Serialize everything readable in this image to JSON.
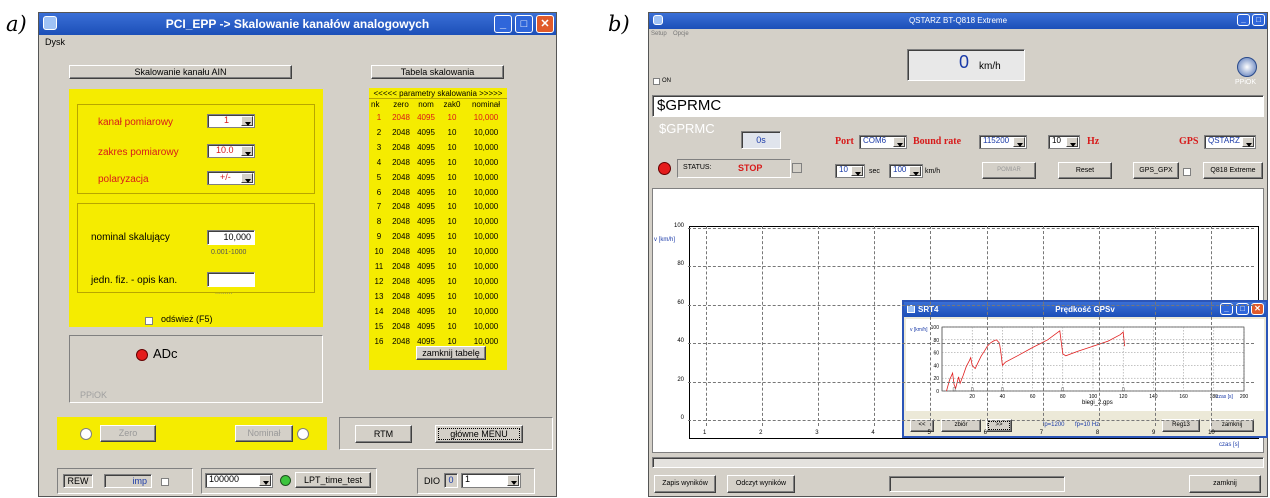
{
  "panel_a": {
    "letter": "a)",
    "title": "PCI_EPP -> Skalowanie kanałów analogowych",
    "menu": "Dysk",
    "btn_ain": "Skalowanie kanału AIN",
    "btn_tabela": "Tabela skalowania",
    "kanal_label": "kanał pomiarowy",
    "kanal_value": "1",
    "zakres_label": "zakres pomiarowy",
    "zakres_value": "10.0",
    "polar_label": "polaryzacja",
    "polar_value": "+/-",
    "nominal_label": "nominal skalujący",
    "nominal_value": "10,000",
    "nominal_range": "0.001-1000",
    "jedn_label": "jedn. fiz. - opis kan.",
    "odswiez": "odśwież (F5)",
    "adc": "ADc",
    "ppiok": "PPiOK",
    "table_header": "<<<<< parametry skalowania >>>>>",
    "table_cols": [
      "nk",
      "zero",
      "nom",
      "zak0",
      "nominał"
    ],
    "rows": [
      [
        "1",
        "2048",
        "4095",
        "10",
        "10,000"
      ],
      [
        "2",
        "2048",
        "4095",
        "10",
        "10,000"
      ],
      [
        "3",
        "2048",
        "4095",
        "10",
        "10,000"
      ],
      [
        "4",
        "2048",
        "4095",
        "10",
        "10,000"
      ],
      [
        "5",
        "2048",
        "4095",
        "10",
        "10,000"
      ],
      [
        "6",
        "2048",
        "4095",
        "10",
        "10,000"
      ],
      [
        "7",
        "2048",
        "4095",
        "10",
        "10,000"
      ],
      [
        "8",
        "2048",
        "4095",
        "10",
        "10,000"
      ],
      [
        "9",
        "2048",
        "4095",
        "10",
        "10,000"
      ],
      [
        "10",
        "2048",
        "4095",
        "10",
        "10,000"
      ],
      [
        "11",
        "2048",
        "4095",
        "10",
        "10,000"
      ],
      [
        "12",
        "2048",
        "4095",
        "10",
        "10,000"
      ],
      [
        "13",
        "2048",
        "4095",
        "10",
        "10,000"
      ],
      [
        "14",
        "2048",
        "4095",
        "10",
        "10,000"
      ],
      [
        "15",
        "2048",
        "4095",
        "10",
        "10,000"
      ],
      [
        "16",
        "2048",
        "4095",
        "10",
        "10,000"
      ]
    ],
    "btn_zamknij_tab": "zamknij tabelę",
    "btn_zero": "Zero",
    "btn_nominal": "Nominał",
    "btn_rtm": "RTM",
    "btn_glowne": "główne MENU",
    "rew": "REW",
    "imp": "imp",
    "combo_100000": "100000",
    "btn_lpt": "LPT_time_test",
    "dio": "DIO",
    "dio_val": "0",
    "dio_combo": "1"
  },
  "panel_b": {
    "letter": "b)",
    "title": "QSTARZ BT-Q818 Extreme",
    "menu": [
      "Setup",
      "Opcje"
    ],
    "speed_value": "0",
    "speed_unit": "km/h",
    "on_label": "ON",
    "gprmc": "$GPRMC",
    "gprmc_ghost": "$GPRMC",
    "ppiok": "PPiOK",
    "zero_s": "0s",
    "port_label": "Port",
    "port_value": "COM6",
    "bound_label": "Bound rate",
    "bound_value": "115200",
    "hz_value": "10",
    "hz_label": "Hz",
    "gps_label": "GPS",
    "gps_value": "QSTARZ",
    "status_label": "STATUS:",
    "status_value": "STOP",
    "sec_value": "10",
    "sec_label": "sec",
    "kmh_value": "100",
    "kmh_label": "km/h",
    "btn_pomiar": "POMIAR",
    "btn_reset": "Reset",
    "btn_gps_gpx": "GPS_GPX",
    "btn_q818": "Q818 Extreme",
    "btn_zapis": "Zapis wyników",
    "btn_odczyt": "Odczyt wyników",
    "btn_zamknij": "zamknij",
    "main_ylabel": "v [km/h]",
    "main_xlabel": "czas [s]",
    "main_yticks": [
      "100",
      "80",
      "60",
      "40",
      "20",
      "0"
    ],
    "main_xticks": [
      "1",
      "2",
      "3",
      "4",
      "5",
      "6",
      "7",
      "8",
      "9",
      "10"
    ],
    "srt4": {
      "label": "SRT4",
      "title": "Prędkość GPSv",
      "ylabel": "v [km/h]",
      "xlabel": "czas [s]",
      "file": "biegi_2.gps",
      "btn_prev": "<<",
      "btn_zbior": "zbiór",
      "btn_next": ">>",
      "lp": "lp=1200",
      "fp": "fp=10 Hz",
      "btn_reg": "Reg13",
      "btn_zamknij": "zamknij"
    }
  },
  "chart_data": {
    "type": "line",
    "title": "Prędkość GPSv",
    "xlabel": "czas [s]",
    "ylabel": "v [km/h]",
    "xlim": [
      0,
      200
    ],
    "ylim": [
      0,
      100
    ],
    "xticks": [
      20,
      40,
      60,
      80,
      100,
      120,
      140,
      160,
      180,
      200
    ],
    "yticks": [
      0,
      20,
      40,
      60,
      80,
      100
    ],
    "grid": true,
    "color": "#e02020",
    "series": [
      {
        "x": [
          3,
          5,
          7,
          8,
          9,
          11,
          12,
          14,
          16,
          18,
          19,
          20,
          22,
          24,
          26,
          28,
          30,
          32,
          34,
          36,
          38,
          39,
          40,
          42,
          50,
          60,
          70,
          78,
          80,
          82,
          90,
          100,
          110,
          118,
          120,
          121
        ],
        "y": [
          0,
          17,
          28,
          10,
          4,
          22,
          12,
          24,
          38,
          47,
          52,
          40,
          35,
          45,
          55,
          62,
          70,
          75,
          78,
          80,
          75,
          60,
          40,
          45,
          55,
          68,
          80,
          94,
          58,
          55,
          62,
          70,
          78,
          88,
          92,
          70
        ]
      }
    ]
  }
}
